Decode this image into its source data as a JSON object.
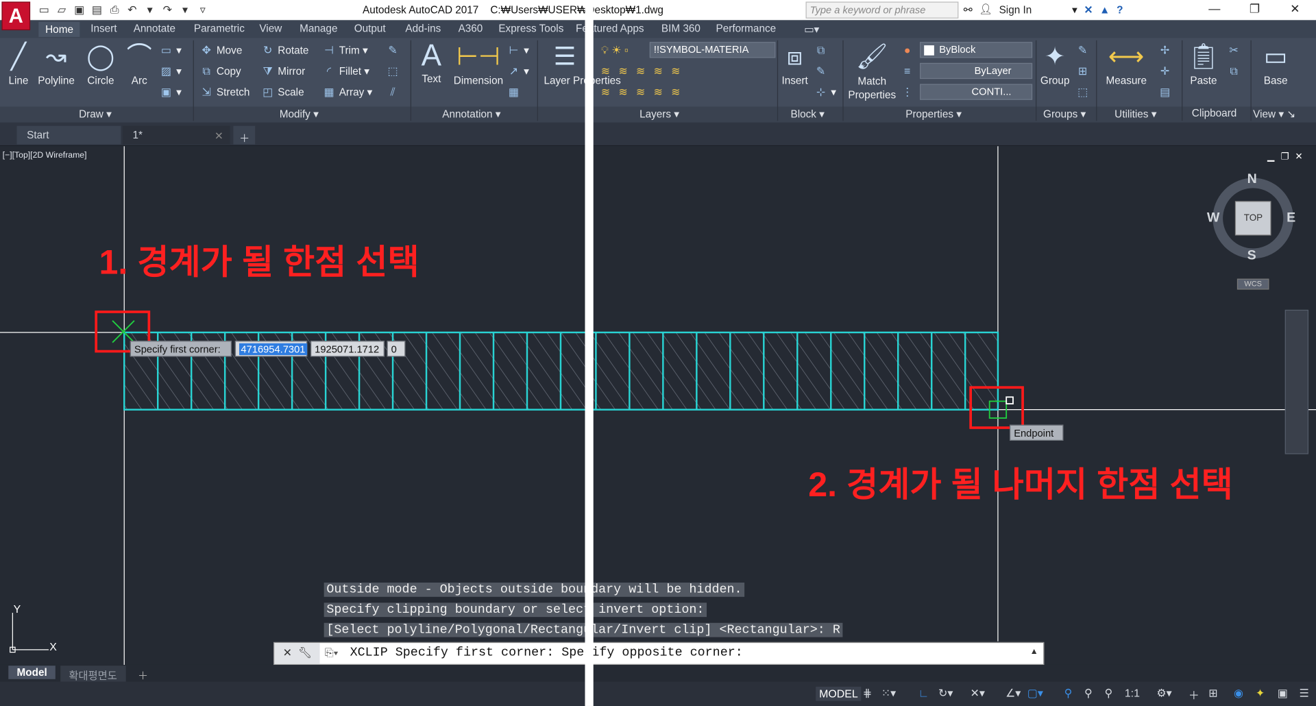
{
  "titlebar": {
    "app_title": "Autodesk AutoCAD 2017",
    "file_path": "C:₩Users₩USER₩Desktop₩1.dwg",
    "search_placeholder": "Type a keyword or phrase",
    "sign_in": "Sign In"
  },
  "ribbon_tabs": [
    "Home",
    "Insert",
    "Annotate",
    "Parametric",
    "View",
    "Manage",
    "Output",
    "Add-ins",
    "A360",
    "Express Tools",
    "Featured Apps",
    "BIM 360",
    "Performance"
  ],
  "draw": {
    "line": "Line",
    "polyline": "Polyline",
    "circle": "Circle",
    "arc": "Arc",
    "panel": "Draw"
  },
  "modify": {
    "move": "Move",
    "rotate": "Rotate",
    "trim": "Trim",
    "copy": "Copy",
    "mirror": "Mirror",
    "fillet": "Fillet",
    "stretch": "Stretch",
    "scale": "Scale",
    "array": "Array",
    "panel": "Modify"
  },
  "annotation": {
    "text": "Text",
    "dimension": "Dimension",
    "panel": "Annotation"
  },
  "layers": {
    "layer_properties": "Layer Properties",
    "current_layer": "!!SYMBOL-MATERIA",
    "panel": "Layers"
  },
  "block": {
    "insert": "Insert",
    "panel": "Block"
  },
  "properties": {
    "match": "Match Properties",
    "color": "ByBlock",
    "linetype": "ByLayer",
    "lineweight": "CONTI...",
    "panel": "Properties"
  },
  "groups": {
    "group": "Group",
    "panel": "Groups"
  },
  "utilities": {
    "measure": "Measure",
    "panel": "Utilities"
  },
  "clipboard": {
    "paste": "Paste",
    "panel": "Clipboard"
  },
  "view": {
    "base": "Base",
    "panel": "View"
  },
  "file_tabs": {
    "start": "Start",
    "drawing": "1*"
  },
  "viewport": {
    "label": "[−][Top][2D Wireframe]",
    "compass": {
      "n": "N",
      "s": "S",
      "e": "E",
      "w": "W",
      "top": "TOP",
      "wcs": "WCS"
    },
    "annotation1": "1. 경계가 될 한점 선택",
    "annotation2": "2. 경계가 될 나머지 한점 선택",
    "tooltip_prompt": "Specify first corner:",
    "tooltip_x": "4716954.7301",
    "tooltip_y": "1925071.1712",
    "tooltip_z": "0",
    "snap_label": "Endpoint",
    "ucs_x": "X",
    "ucs_y": "Y"
  },
  "command_history": [
    "Outside mode - Objects outside boundary will be hidden.",
    "Specify clipping boundary or select invert option:",
    "[Select polyline/Polygonal/Rectangular/Invert clip] <Rectangular>: R"
  ],
  "command_line": "XCLIP Specify first corner: Specify opposite corner:",
  "layout_tabs": {
    "model": "Model",
    "layout1": "확대평면도"
  },
  "status": {
    "model": "MODEL",
    "scale": "1:1"
  }
}
